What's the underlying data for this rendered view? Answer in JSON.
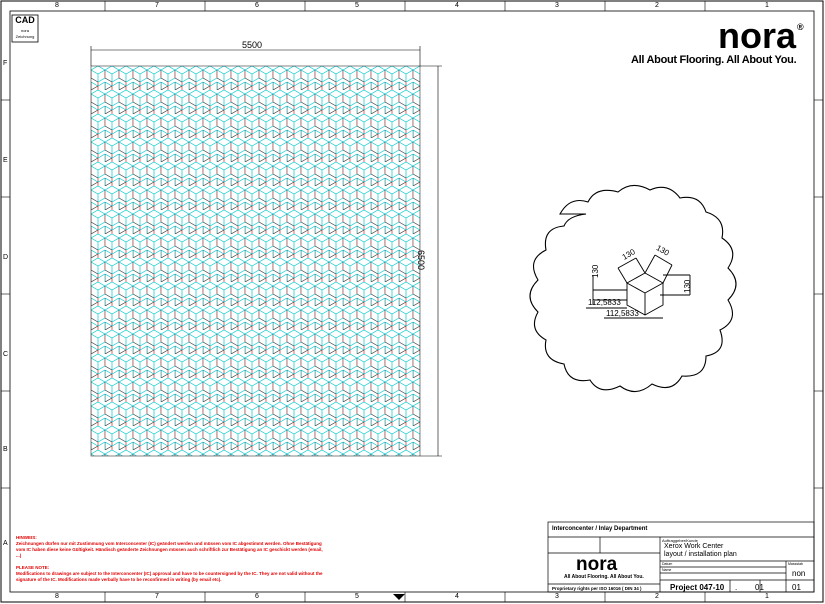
{
  "cad_stamp": {
    "title": "CAD",
    "line1": "nora",
    "line2": "Zeichnung"
  },
  "brand": {
    "logo": "nora",
    "registered": "®",
    "tagline": "All About Flooring. All About You."
  },
  "column_labels": [
    "8",
    "7",
    "6",
    "5",
    "4",
    "3",
    "2",
    "1"
  ],
  "row_labels": [
    "F",
    "E",
    "D",
    "C",
    "B",
    "A"
  ],
  "drawing": {
    "width_dim": "5500",
    "height_dim": "6500",
    "detail": {
      "dim_a": "130",
      "dim_b": "130",
      "dim_c": "130",
      "dim_d": "130",
      "dim_e": "112,5833",
      "dim_f": "112,5833"
    }
  },
  "notes": {
    "de_heading": "HINWEIS:",
    "de_text": "Zeichnungen dürfen nur mit Zustimmung vom Interconcenter (IC) geändert werden und müssen vom IC abgestimmt werden. Ohne Bestätigung vom IC haben diese keine Gültigkeit. Händisch geänderte Zeichnungen müssen auch schriftlich zur Bestätigung an IC geschickt werden (email, ...)",
    "en_heading": "PLEASE NOTE:",
    "en_text": "Modifications to drawings are subject to the Interconcenter (IC) approval and have to be countersigned by the IC. They are not valid without the signature of the IC. Modifications made verbally have to be reconfirmed in writing (by email etc)."
  },
  "title_block": {
    "department": "Interconcenter / Inlay Department",
    "customer_label": "Auftraggeber/Kunde",
    "customer_value": "Xerox Work Center",
    "subtitle": "layout / installation plan",
    "date_label": "Datum",
    "name_label": "Name",
    "scale_label": "Massstab",
    "scale_value": "non",
    "project": "Project 047-10",
    "sheet": "01",
    "revision": "01",
    "separator": ".",
    "rights": "Proprietary rights per ISO 16016 ( DIN 34 )"
  }
}
